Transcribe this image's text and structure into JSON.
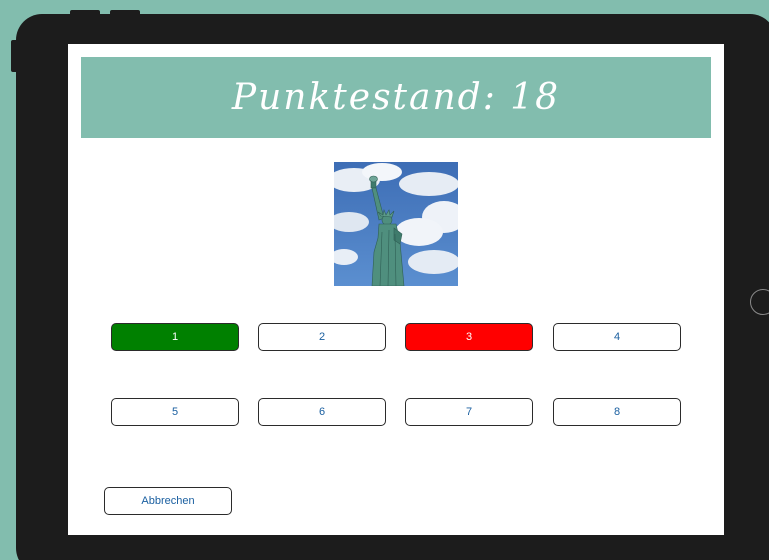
{
  "colors": {
    "background": "#82bdae",
    "tablet_frame": "#1c1c1c",
    "banner": "#82bdae",
    "correct": "#008000",
    "wrong": "#ff0000",
    "button_text": "#1a5fa0"
  },
  "header": {
    "score_text": "Punktestand: 18"
  },
  "question": {
    "image": "statue-of-liberty-image"
  },
  "answers": [
    {
      "label": "1",
      "state": "correct"
    },
    {
      "label": "2",
      "state": "neutral"
    },
    {
      "label": "3",
      "state": "wrong"
    },
    {
      "label": "4",
      "state": "neutral"
    },
    {
      "label": "5",
      "state": "neutral"
    },
    {
      "label": "6",
      "state": "neutral"
    },
    {
      "label": "7",
      "state": "neutral"
    },
    {
      "label": "8",
      "state": "neutral"
    }
  ],
  "footer": {
    "cancel_label": "Abbrechen"
  }
}
